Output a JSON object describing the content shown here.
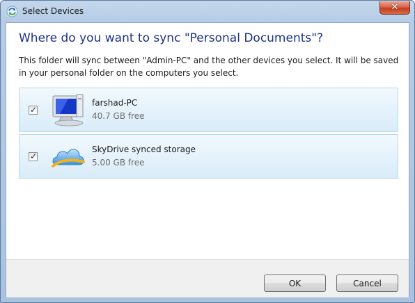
{
  "window": {
    "title": "Select Devices",
    "close_glyph": "✕"
  },
  "dialog": {
    "heading": "Where do you want to sync \"Personal Documents\"?",
    "description": "This folder will sync between \"Admin-PC\" and the other devices you select. It will be saved in your personal folder on the computers you select.",
    "devices": [
      {
        "name": "farshad-PC",
        "free": "40.7 GB free",
        "checked": true,
        "icon": "computer-icon"
      },
      {
        "name": "SkyDrive synced storage",
        "free": "5.00 GB free",
        "checked": true,
        "icon": "cloud-icon"
      }
    ],
    "check_glyph": "✓"
  },
  "footer": {
    "ok_label": "OK",
    "cancel_label": "Cancel"
  },
  "colors": {
    "heading": "#1e3287",
    "item_border": "#b9d7ea",
    "item_bg": "#e3f1fb"
  }
}
